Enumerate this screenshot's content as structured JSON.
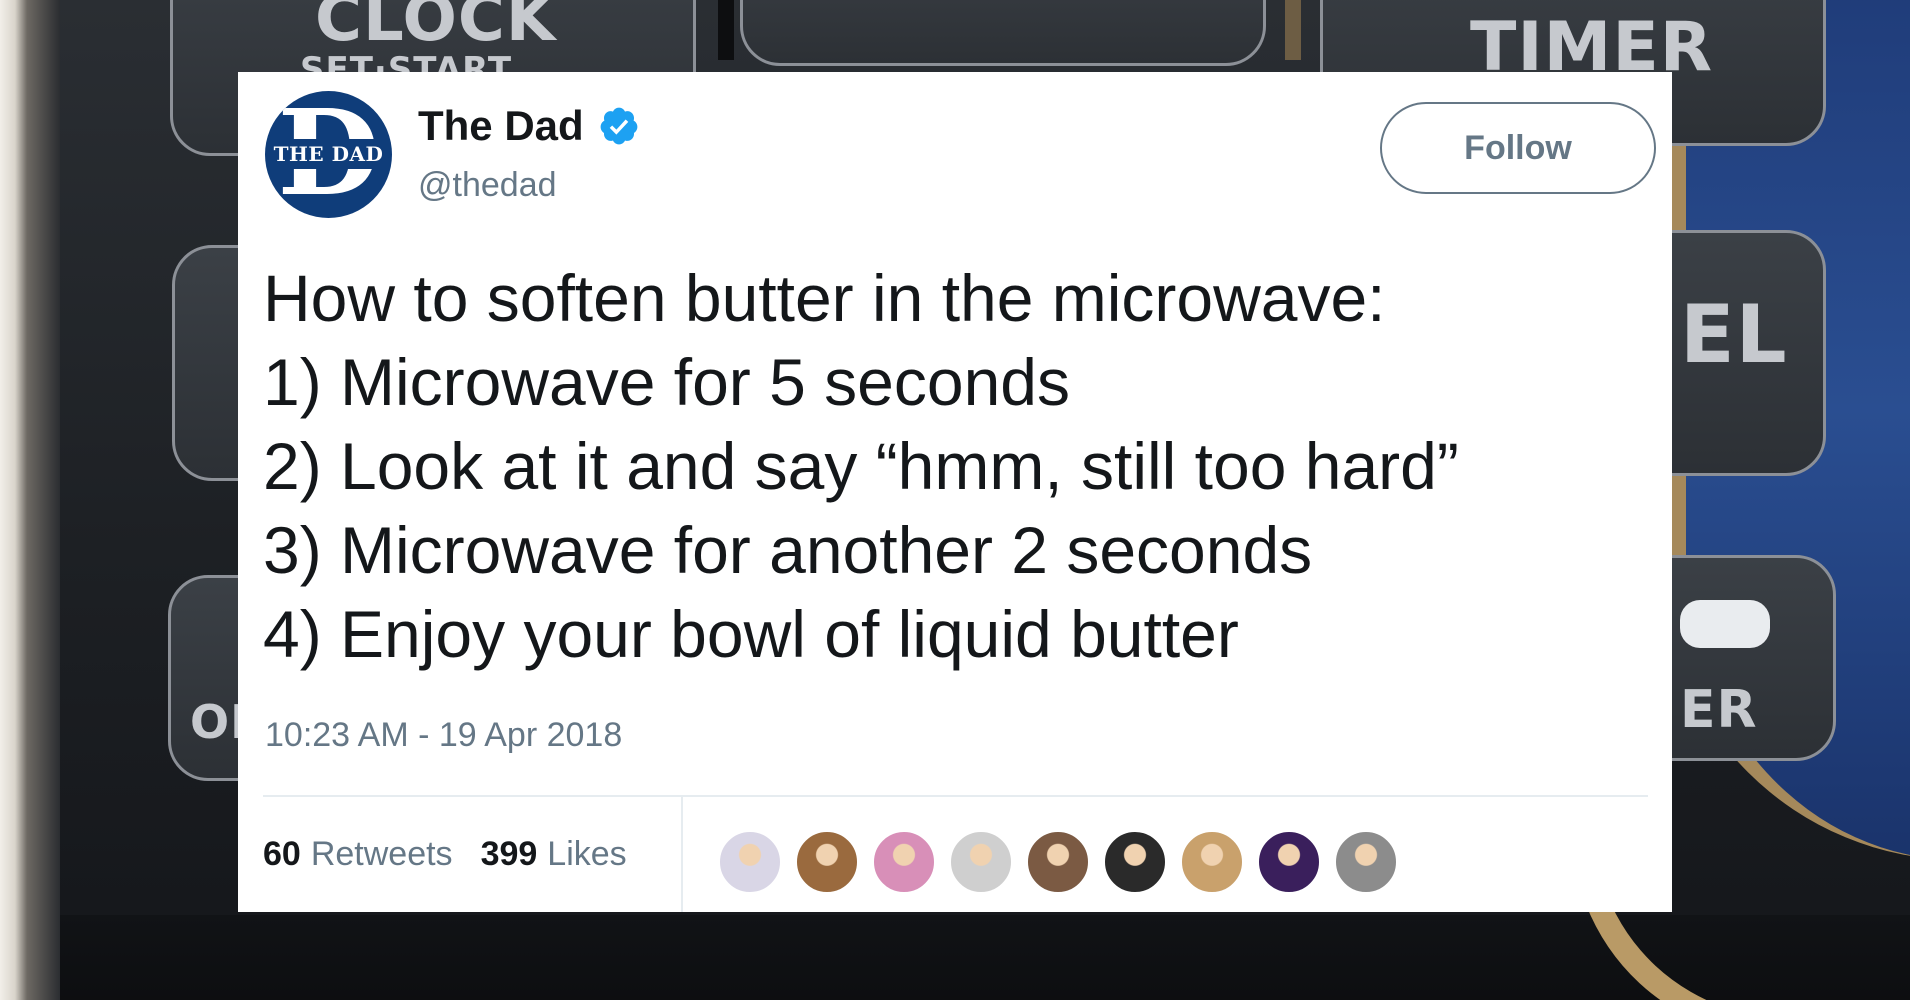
{
  "background": {
    "labels": [
      "CLOCK",
      "SET·START",
      "TIMER",
      "EL",
      "ON",
      "ER"
    ]
  },
  "tweet": {
    "author_name": "The Dad",
    "handle": "@thedad",
    "avatar_letter": "D",
    "avatar_banner": "THE DAD",
    "verified": true,
    "follow_label": "Follow",
    "lines": [
      "How to soften butter in the microwave:",
      "1) Microwave for 5 seconds",
      "2) Look at it and say “hmm, still too hard”",
      "3) Microwave for another 2 seconds",
      "4) Enjoy your bowl of liquid butter"
    ],
    "timestamp": "10:23 AM - 19 Apr 2018",
    "retweets": {
      "count": "60",
      "label": "Retweets"
    },
    "likes": {
      "count": "399",
      "label": "Likes"
    },
    "liker_avatars": [
      {
        "color": "#d9d6e6"
      },
      {
        "color": "#9a6a3e"
      },
      {
        "color": "#d88fb8"
      },
      {
        "color": "#cfcfcf"
      },
      {
        "color": "#7b5a43"
      },
      {
        "color": "#2a2a2a"
      },
      {
        "color": "#c9a16c"
      },
      {
        "color": "#3a1f5c"
      },
      {
        "color": "#8c8c8c"
      }
    ]
  },
  "colors": {
    "text": "#14171a",
    "secondary": "#657786",
    "verified_blue": "#1da1f2",
    "avatar_navy": "#0f3d7a"
  }
}
